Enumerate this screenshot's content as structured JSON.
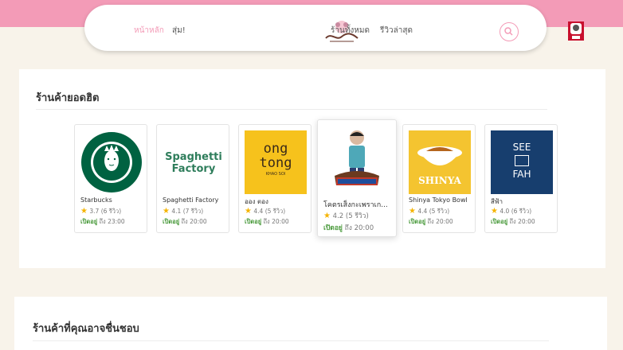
{
  "nav": {
    "home": "หน้าหลัก",
    "random": "สุ่ม!",
    "all_shops": "ร้านทั้งหมด",
    "latest_reviews": "รีวิวล่าสุด",
    "logo_icon": "rimmablee-logo",
    "search_icon": "search-icon",
    "profile_icon": "kfc-avatar-icon"
  },
  "colors": {
    "accent": "#f39bb7",
    "open": "#4a9a3c",
    "star": "#f5b400",
    "background": "#f8f3ea"
  },
  "popular": {
    "title": "ร้านค้ายอดฮิต",
    "shops": [
      {
        "name": "Starbucks",
        "rating": "3.7",
        "reviews": "(6 รีวิว)",
        "open_label": "เปิดอยู่",
        "open_until": "ถึง 23:00"
      },
      {
        "name": "Spaghetti Factory",
        "rating": "4.1",
        "reviews": "(7 รีวิว)",
        "open_label": "เปิดอยู่",
        "open_until": "ถึง 20:00",
        "logo_text_1": "Spaghetti",
        "logo_text_2": "Factory"
      },
      {
        "name": "ออง ตอง",
        "rating": "4.4",
        "reviews": "(5 รีวิว)",
        "open_label": "เปิดอยู่",
        "open_until": "ถึง 20:00",
        "logo_text_1": "ong",
        "logo_text_2": "tong",
        "logo_text_3": "KHAO SOI"
      },
      {
        "name": "โคตรเส็งกะเพราเก...",
        "rating": "4.2",
        "reviews": "(5 รีวิว)",
        "open_label": "เปิดอยู่",
        "open_until": "ถึง 20:00"
      },
      {
        "name": "Shinya Tokyo Bowl",
        "rating": "4.4",
        "reviews": "(5 รีวิว)",
        "open_label": "เปิดอยู่",
        "open_until": "ถึง 20:00",
        "logo_text_1": "SHINYA"
      },
      {
        "name": "สีฟ้า",
        "rating": "4.0",
        "reviews": "(6 รีวิว)",
        "open_label": "เปิดอยู่",
        "open_until": "ถึง 20:00",
        "logo_text_1": "SEE",
        "logo_text_2": "FAH"
      }
    ]
  },
  "recommended": {
    "title": "ร้านค้าที่คุณอาจชื่นชอบ"
  }
}
